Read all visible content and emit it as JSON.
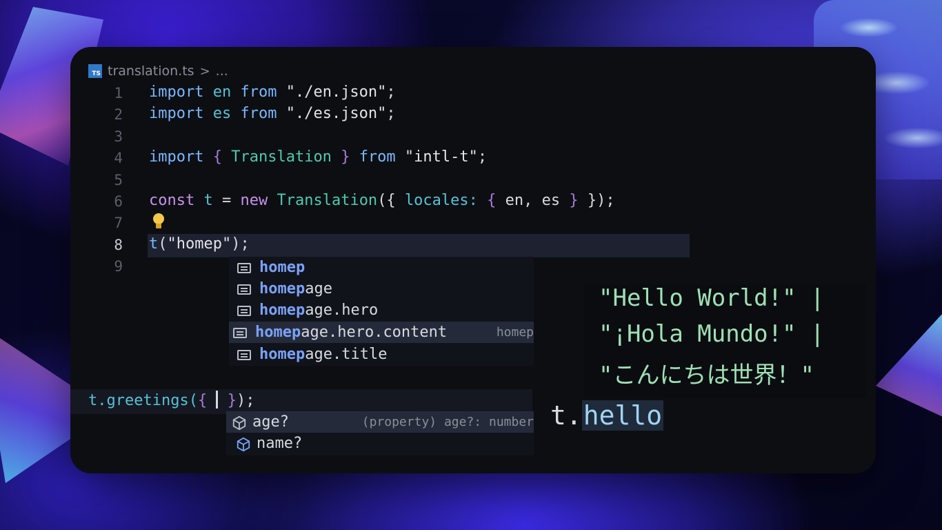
{
  "breadcrumb": {
    "file_icon": "TS",
    "filename": "translation.ts",
    "separator": ">",
    "rest": "..."
  },
  "gutter": [
    "1",
    "2",
    "3",
    "4",
    "5",
    "6",
    "7",
    "8",
    "9"
  ],
  "code": {
    "line1": {
      "import": "import",
      "id": "en",
      "from": "from",
      "path": "\"./en.json\"",
      "end": ";"
    },
    "line2": {
      "import": "import",
      "id": "es",
      "from": "from",
      "path": "\"./es.json\"",
      "end": ";"
    },
    "line4": {
      "import": "import",
      "open": "{",
      "type": "Translation",
      "close": "}",
      "from": "from",
      "path": "\"intl-t\"",
      "end": ";"
    },
    "line6": {
      "const": "const",
      "id": "t",
      "eq": "=",
      "new": "new",
      "type": "Translation",
      "open": "({",
      "key": "locales:",
      "bopen": "{",
      "vals": "en, es",
      "bclose": "}",
      "close": "});"
    },
    "line8": {
      "fn": "t",
      "open": "(",
      "str": "\"homep\"",
      "close": ");"
    }
  },
  "suggestions": [
    {
      "match": "homep",
      "rest": "",
      "detail": ""
    },
    {
      "match": "homep",
      "rest": "age",
      "detail": ""
    },
    {
      "match": "homep",
      "rest": "age.hero",
      "detail": ""
    },
    {
      "match": "homep",
      "rest": "age.hero.content",
      "detail": "homep"
    },
    {
      "match": "homep",
      "rest": "age.title",
      "detail": ""
    }
  ],
  "preview": {
    "line1": "\"Hello World!\" |",
    "line2": "\"¡Hola Mundo!\" |",
    "line3": "\"こんにちは世界！\""
  },
  "greetings": {
    "prefix": "t.greetings(",
    "open": "{",
    "close": "}",
    "end": ");"
  },
  "hello": {
    "prefix": "t.",
    "prop": "hello"
  },
  "props": [
    {
      "label": "age?",
      "detail": "(property) age?: number"
    },
    {
      "label": "name?",
      "detail": ""
    }
  ],
  "icons": {
    "file": "typescript-file-icon",
    "suggestion": "text-list-icon",
    "property": "cube-icon",
    "bulb": "lightbulb-icon"
  }
}
